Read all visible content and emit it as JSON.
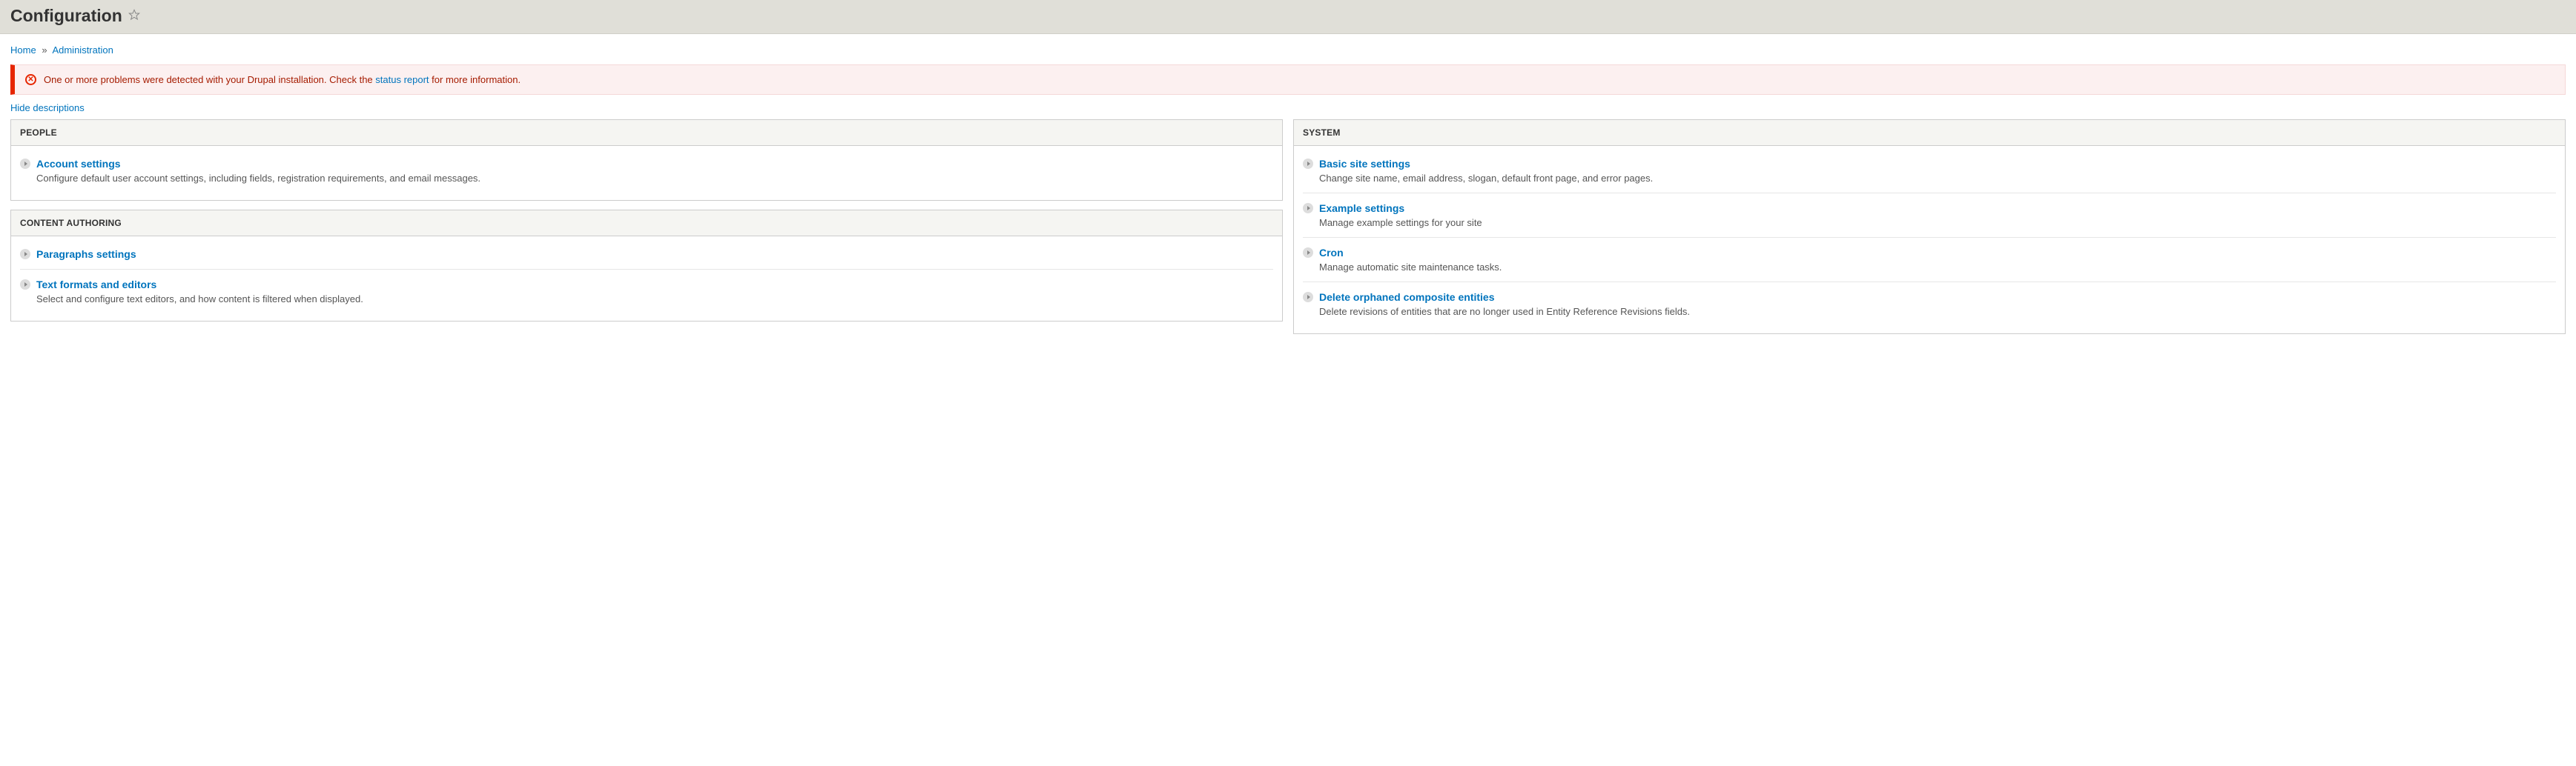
{
  "header": {
    "title": "Configuration"
  },
  "breadcrumbs": {
    "home": "Home",
    "sep": "»",
    "admin": "Administration"
  },
  "error": {
    "prefix": "One or more problems were detected with your Drupal installation. Check the ",
    "link": "status report",
    "suffix": " for more information."
  },
  "hide_descriptions": "Hide descriptions",
  "left": [
    {
      "title": "PEOPLE",
      "items": [
        {
          "label": "Account settings",
          "desc": "Configure default user account settings, including fields, registration requirements, and email messages."
        }
      ]
    },
    {
      "title": "CONTENT AUTHORING",
      "items": [
        {
          "label": "Paragraphs settings",
          "desc": ""
        },
        {
          "label": "Text formats and editors",
          "desc": "Select and configure text editors, and how content is filtered when displayed."
        }
      ]
    }
  ],
  "right": [
    {
      "title": "SYSTEM",
      "items": [
        {
          "label": "Basic site settings",
          "desc": "Change site name, email address, slogan, default front page, and error pages."
        },
        {
          "label": "Example settings",
          "desc": "Manage example settings for your site"
        },
        {
          "label": "Cron",
          "desc": "Manage automatic site maintenance tasks."
        },
        {
          "label": "Delete orphaned composite entities",
          "desc": "Delete revisions of entities that are no longer used in Entity Reference Revisions fields."
        }
      ]
    }
  ]
}
